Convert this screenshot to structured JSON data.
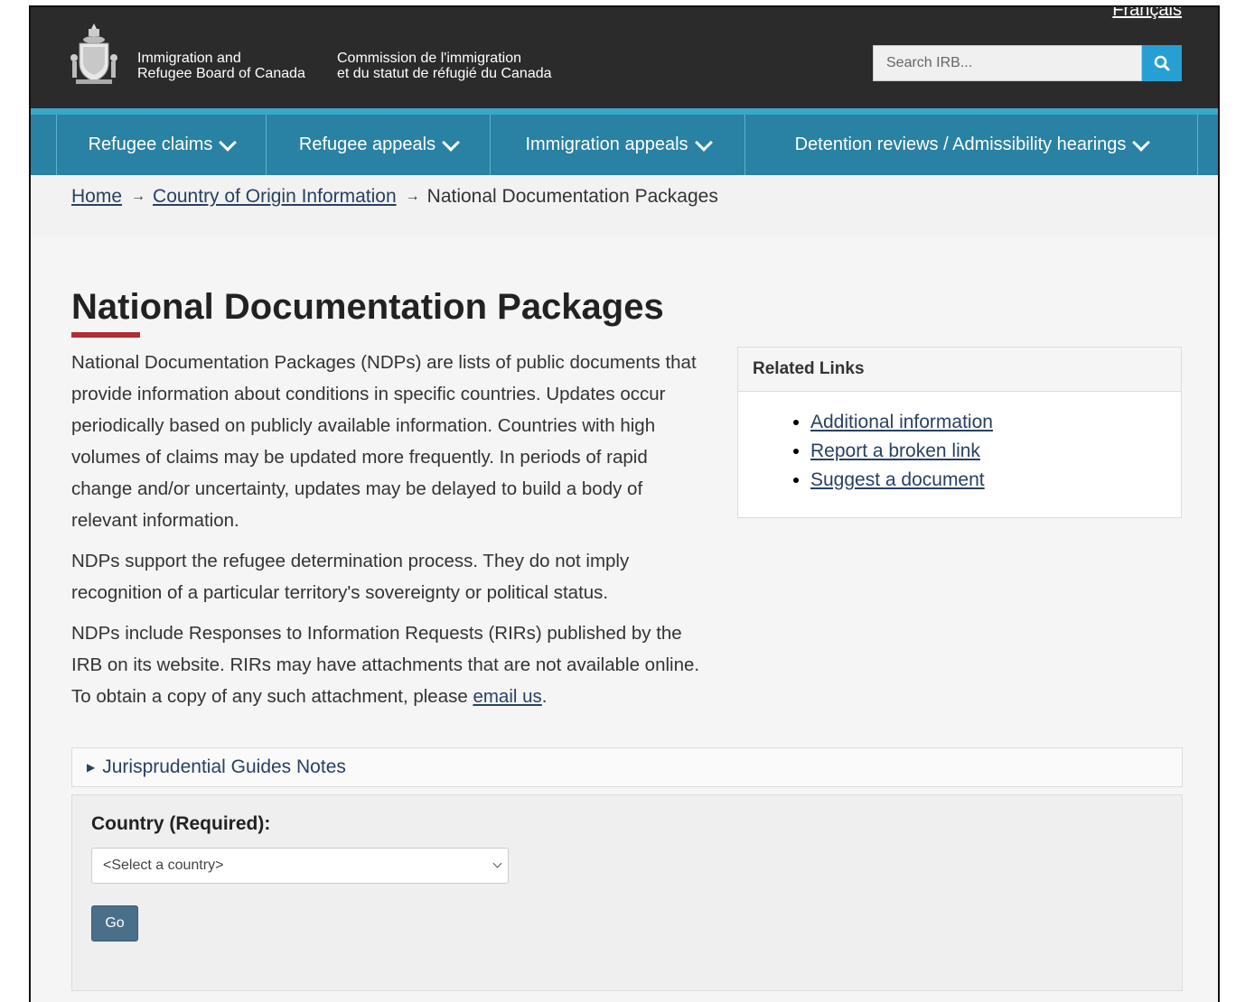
{
  "header": {
    "language_toggle": "Français",
    "signature_en_line1": "Immigration and",
    "signature_en_line2": "Refugee Board of Canada",
    "signature_fr_line1": "Commission de l'immigration",
    "signature_fr_line2": "et du statut de réfugié du Canada",
    "search_placeholder": "Search IRB...",
    "search_icon": "search-icon"
  },
  "nav": {
    "items": [
      {
        "label": "Refugee claims"
      },
      {
        "label": "Refugee appeals"
      },
      {
        "label": "Immigration appeals"
      },
      {
        "label": "Detention reviews / Admissibility hearings"
      }
    ]
  },
  "breadcrumb": {
    "home": "Home",
    "coi": "Country of Origin Information",
    "current": "National Documentation Packages",
    "arrow": "→"
  },
  "main": {
    "title": "National Documentation Packages",
    "para1": "National Documentation Packages (NDPs) are lists of public documents that provide information about conditions in specific countries. Updates occur periodically based on publicly available information. Countries with high volumes of claims may be updated more frequently. In periods of rapid change and/or uncertainty, updates may be delayed to build a body of relevant information.",
    "para2": "NDPs support the refugee determination process. They do not imply recognition of a particular territory's sovereignty or political status.",
    "para3_prefix": "NDPs include Responses to Information Requests (RIRs) published by the IRB on its website. RIRs may have attachments that are not available online. To obtain a copy of any such attachment, please ",
    "para3_link": "email us",
    "para3_suffix": "."
  },
  "related": {
    "heading": "Related Links",
    "links": [
      {
        "label": "Additional information"
      },
      {
        "label": "Report a broken link"
      },
      {
        "label": "Suggest a document"
      }
    ]
  },
  "jurisprudential": {
    "label": "Jurisprudential Guides Notes"
  },
  "form": {
    "country_label": "Country (Required):",
    "select_value": "<Select a country>",
    "go_label": "Go"
  },
  "colors": {
    "header_bg": "#2b2b2b",
    "nav_bg": "#2981a3",
    "search_button": "#26a0d4",
    "title_accent": "#b22c33",
    "link": "#284162",
    "go_button": "#4a6f8a"
  }
}
